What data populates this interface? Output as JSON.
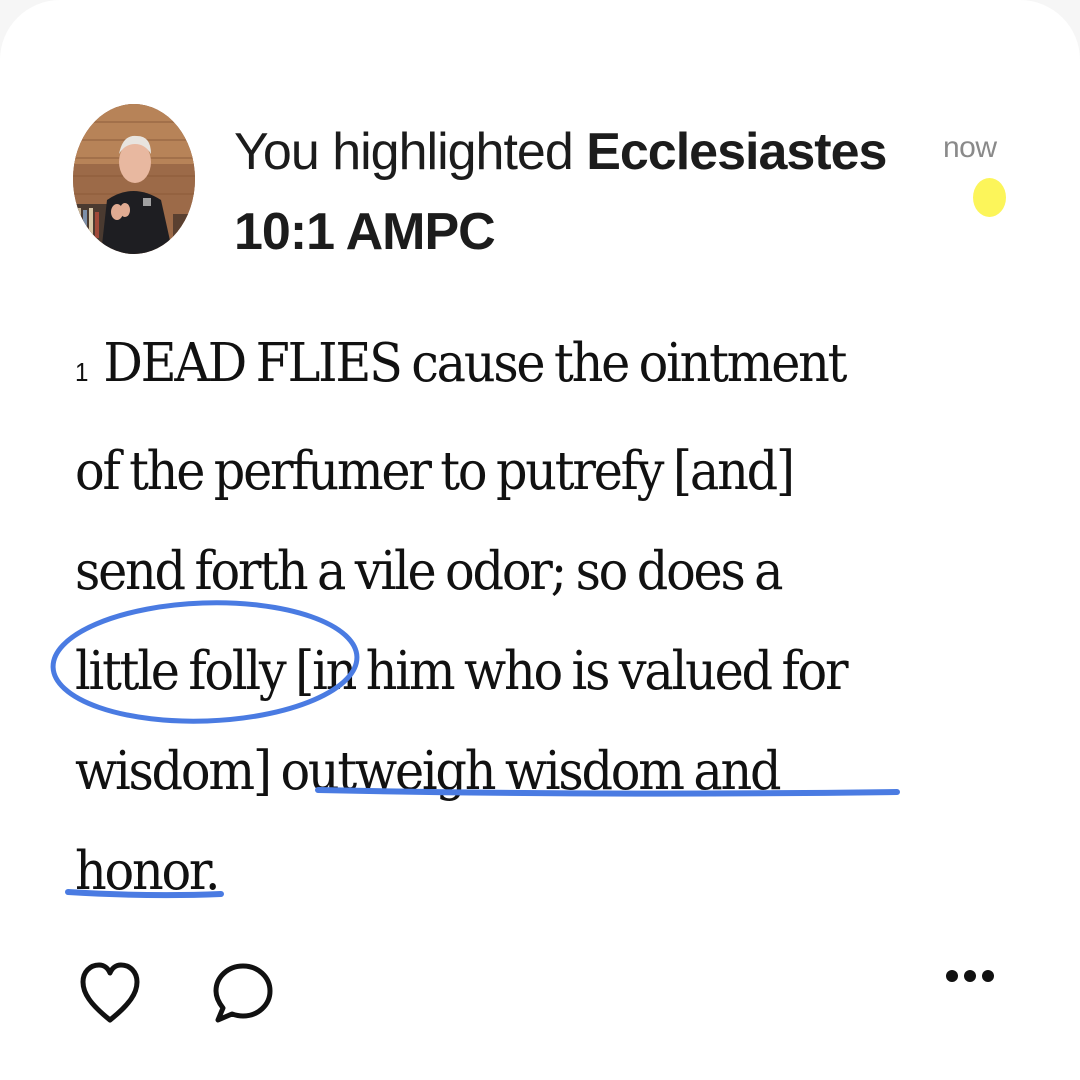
{
  "activity": {
    "prefix": "You highlighted ",
    "book": "Ecclesiastes",
    "reference": "10:1 AMPC",
    "timestamp": "now",
    "highlight_color": "#fcf55a"
  },
  "verse": {
    "number": "1",
    "lines": [
      "DEAD FLIES cause the ointment",
      "of the perfumer to putrefy [and]",
      "send forth a vile odor; so does a",
      "little folly [in him who is valued for",
      "wisdom] outweigh wisdom and",
      "honor."
    ],
    "annotation_color": "#4a7be2"
  },
  "actions": {
    "like_icon": "heart-icon",
    "comment_icon": "comment-bubble-icon",
    "more_icon": "more-icon"
  }
}
